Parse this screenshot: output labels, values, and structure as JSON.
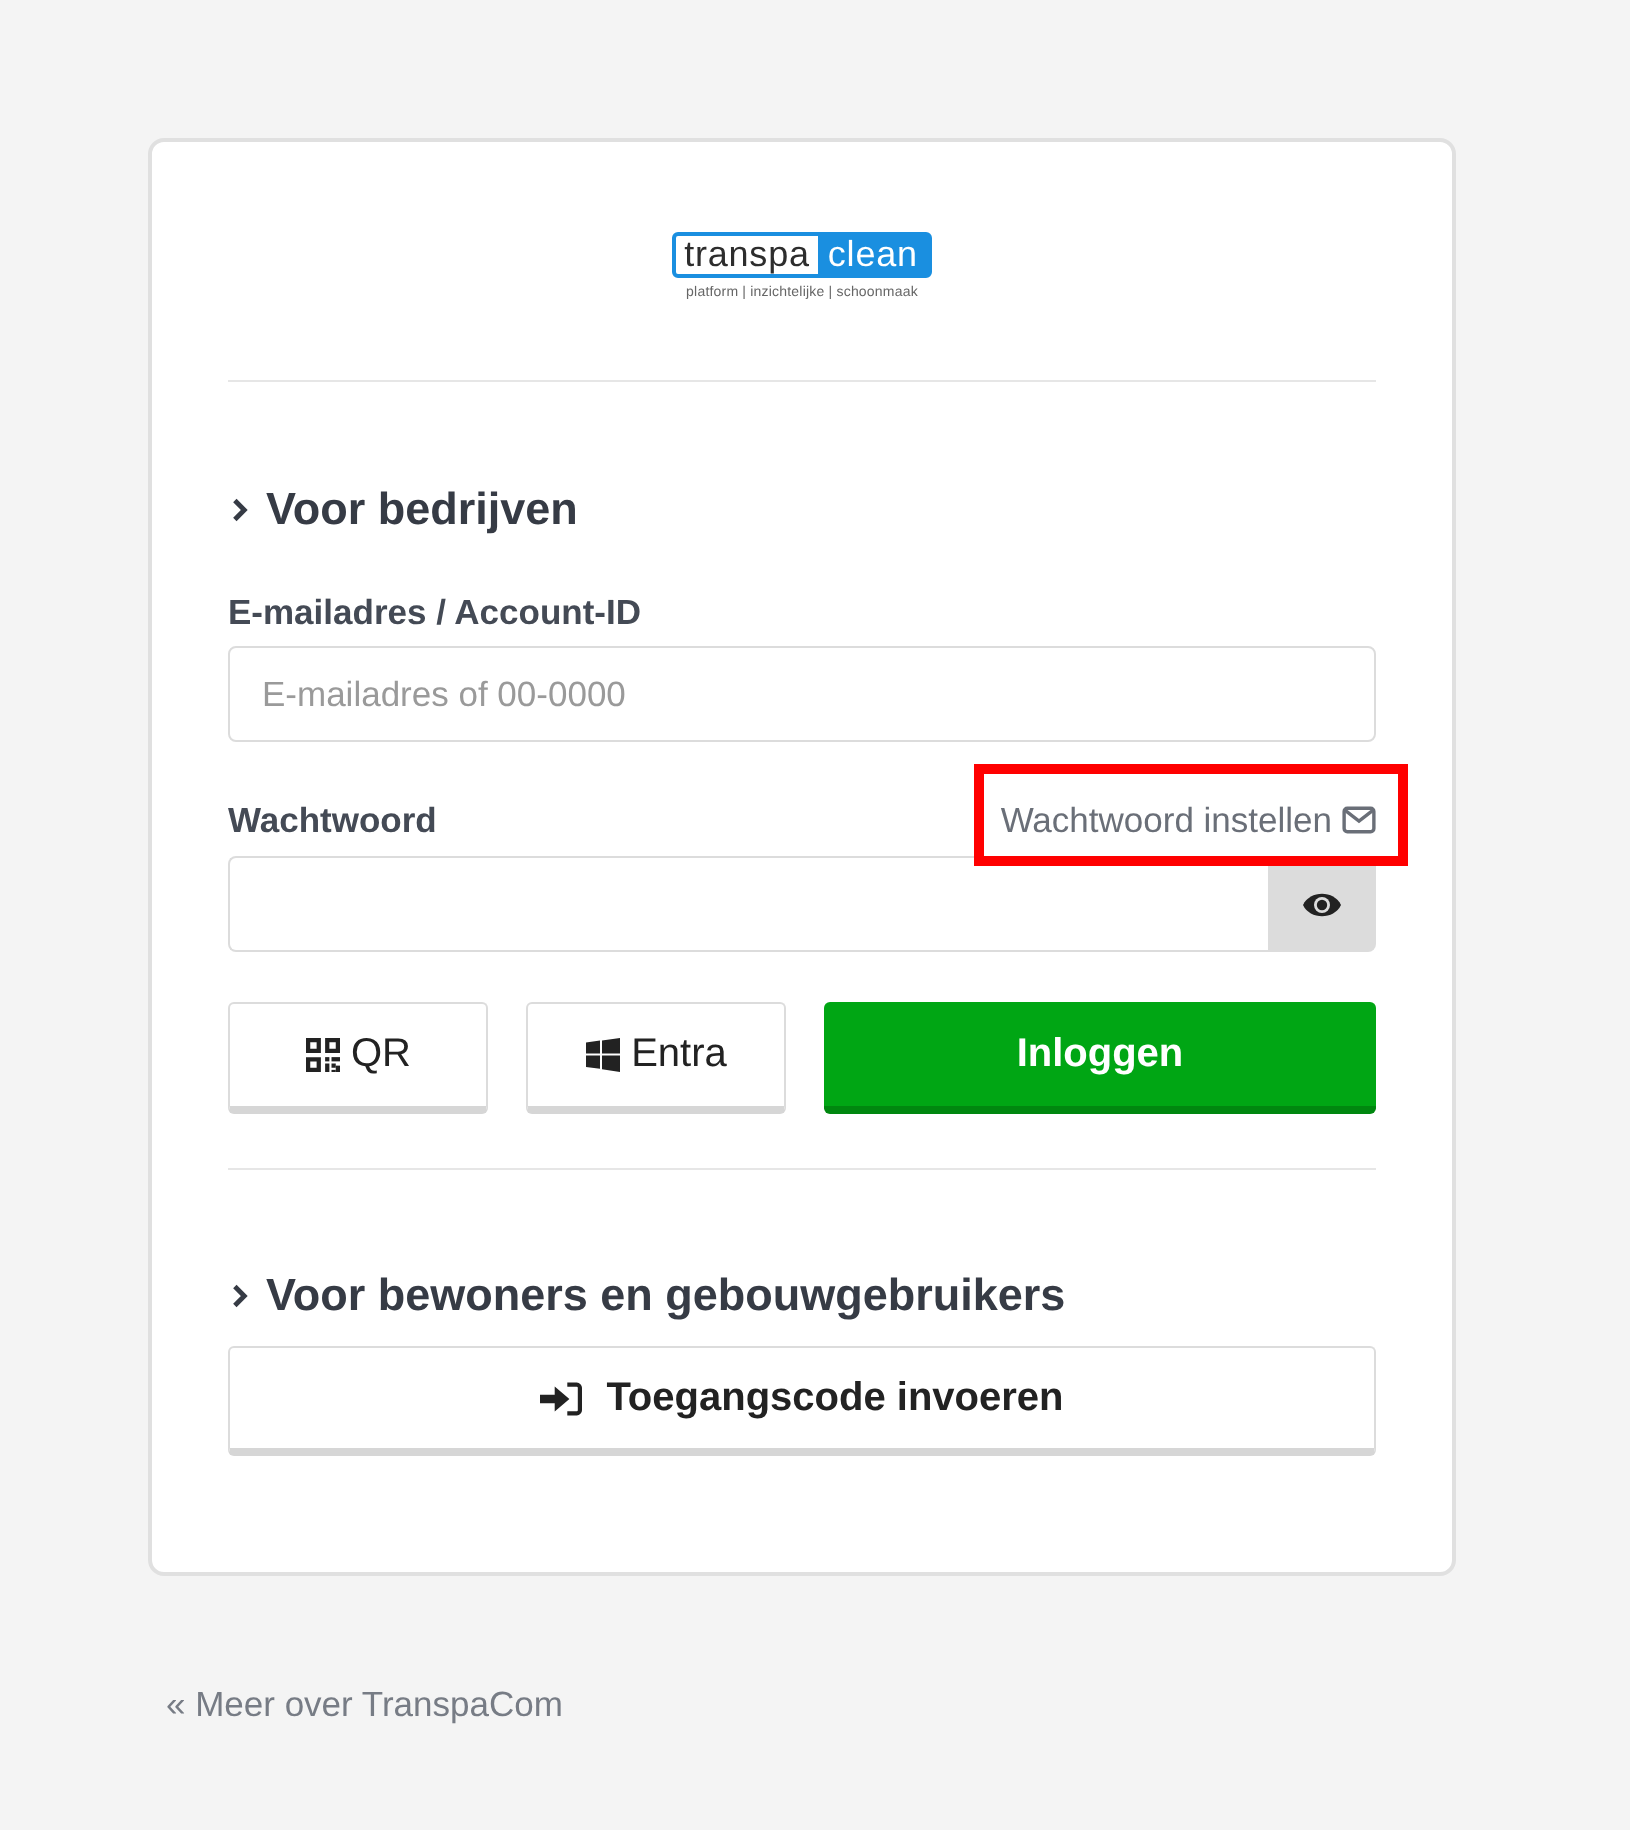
{
  "logo": {
    "word_dark": "transpa",
    "word_light": "clean",
    "tagline": "platform | inzichtelijke | schoonmaak"
  },
  "business": {
    "heading": "Voor bedrijven",
    "email": {
      "label": "E-mailadres / Account-ID",
      "placeholder": "E-mailadres of 00-0000"
    },
    "password": {
      "label": "Wachtwoord",
      "link": {
        "text": "Wachtwoord instellen",
        "highlighted": true
      }
    },
    "buttons": [
      {
        "kind": "qr",
        "label": "QR"
      },
      {
        "kind": "panes",
        "label": "Entra"
      },
      {
        "kind": "primary",
        "label": "Inloggen"
      }
    ]
  },
  "residents": {
    "heading": "Voor bewoners en gebouwgebruikers",
    "button": {
      "label": "Toegangscode invoeren"
    }
  },
  "footer_link": "« Meer over TranspaCom"
}
